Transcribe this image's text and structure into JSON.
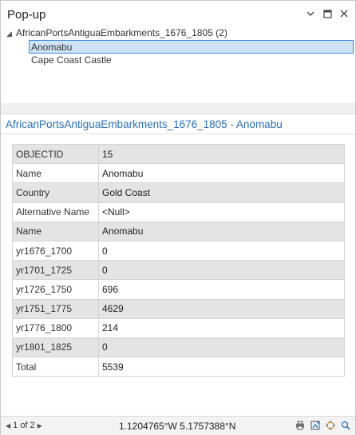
{
  "window": {
    "title": "Pop-up"
  },
  "tree": {
    "layer": "AfricanPortsAntiguaEmbarkments_1676_1805 (2)",
    "items": [
      "Anomabu",
      "Cape Coast Castle"
    ],
    "selected_index": 0
  },
  "detail": {
    "title": "AfricanPortsAntiguaEmbarkments_1676_1805 - Anomabu",
    "rows": [
      {
        "field": "OBJECTID",
        "value": "15"
      },
      {
        "field": "Name",
        "value": "Anomabu"
      },
      {
        "field": "Country",
        "value": "Gold Coast"
      },
      {
        "field": "Alternative Name",
        "value": "<Null>"
      },
      {
        "field": "Name",
        "value": "Anomabu"
      },
      {
        "field": "yr1676_1700",
        "value": "0"
      },
      {
        "field": "yr1701_1725",
        "value": "0"
      },
      {
        "field": "yr1726_1750",
        "value": "696"
      },
      {
        "field": "yr1751_1775",
        "value": "4629"
      },
      {
        "field": "yr1776_1800",
        "value": "214"
      },
      {
        "field": "yr1801_1825",
        "value": "0"
      },
      {
        "field": "Total",
        "value": "5539"
      }
    ]
  },
  "status": {
    "page": "1 of 2",
    "coordinates": "1.1204765°W 5.1757388°N"
  },
  "icons": [
    "chevron-down-icon",
    "maximize-icon",
    "close-icon",
    "print-icon",
    "zoom-to-icon",
    "pan-to-icon",
    "magnify-icon"
  ]
}
